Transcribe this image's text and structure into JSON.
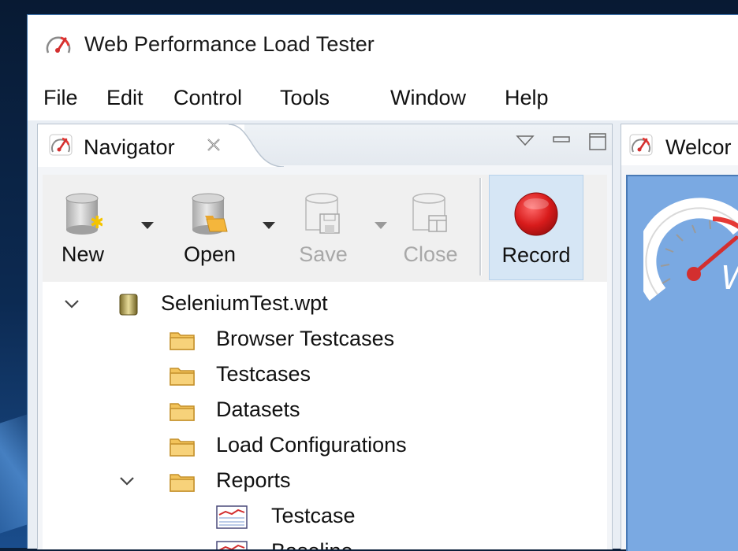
{
  "window": {
    "title": "Web Performance Load Tester"
  },
  "menu": {
    "items": [
      "File",
      "Edit",
      "Control",
      "Tools",
      "Window",
      "Help"
    ]
  },
  "navigator": {
    "tab_label": "Navigator",
    "toolbar": {
      "new_label": "New",
      "open_label": "Open",
      "save_label": "Save",
      "close_label": "Close",
      "record_label": "Record"
    },
    "tree": {
      "root": "SeleniumTest.wpt",
      "folders": [
        "Browser Testcases",
        "Testcases",
        "Datasets",
        "Load Configurations",
        "Reports"
      ],
      "reports": [
        "Testcase",
        "Baseline"
      ]
    }
  },
  "welcome": {
    "tab_label": "Welcor",
    "body_fragment": "W"
  },
  "colors": {
    "accent": "#d32f2f",
    "welcome_bg": "#7aa9e2",
    "record_bg": "#d6e6f5"
  }
}
